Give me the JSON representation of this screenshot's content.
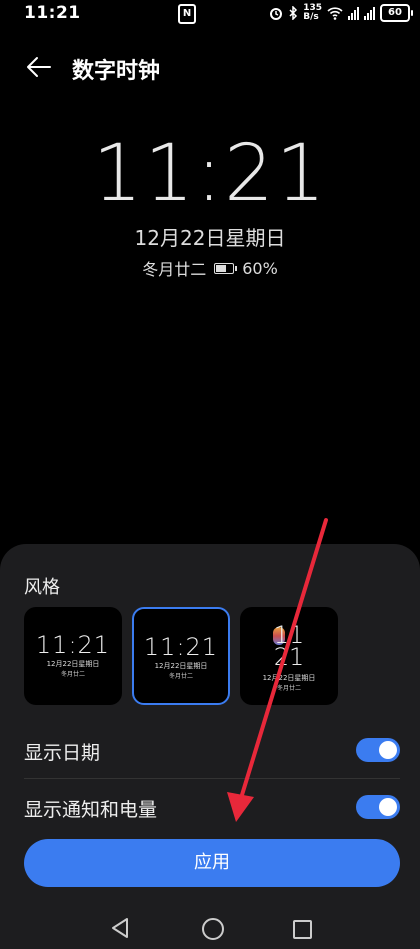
{
  "status_bar": {
    "time": "11:21",
    "nfc_label": "N",
    "speed_value": "135",
    "speed_unit": "B/s",
    "battery": "60"
  },
  "header": {
    "title": "数字时钟"
  },
  "preview": {
    "time": "11:21",
    "date": "12月22日星期日",
    "lunar": "冬月廿二",
    "battery": "60%"
  },
  "sheet": {
    "style_label": "风格",
    "cards": [
      {
        "time": "11:21",
        "date": "12月22日星期日",
        "lunar": "冬月廿二"
      },
      {
        "time": "11:21",
        "date": "12月22日星期日",
        "lunar": "冬月廿二"
      },
      {
        "digit_top": "11",
        "digit_bottom": "21",
        "date": "12月22日星期日",
        "lunar": "冬月廿二"
      }
    ],
    "show_date_label": "显示日期",
    "show_notify_label": "显示通知和电量",
    "apply_label": "应用"
  },
  "colors": {
    "accent": "#3b7cf0",
    "sheet_bg": "#1d1d1f",
    "annotation_arrow": "#e8283a"
  }
}
